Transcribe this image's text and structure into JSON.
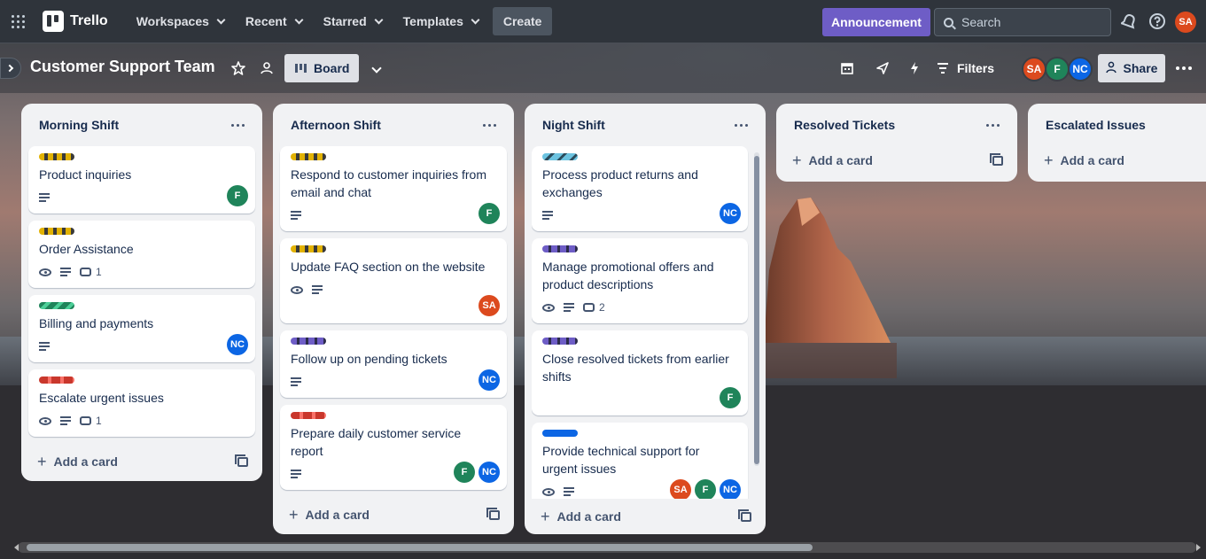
{
  "topnav": {
    "logo": "Trello",
    "menus": [
      "Workspaces",
      "Recent",
      "Starred",
      "Templates"
    ],
    "create_label": "Create",
    "announcement_label": "Announcement",
    "search_placeholder": "Search",
    "user_initials": "SA"
  },
  "board": {
    "title": "Customer Support Team",
    "view_label": "Board",
    "filters_label": "Filters",
    "share_label": "Share",
    "members": [
      "SA",
      "F",
      "NC"
    ]
  },
  "lists": [
    {
      "title": "Morning Shift",
      "add_card_label": "Add a card",
      "cards": [
        {
          "title": "Product inquiries",
          "label": "yellow",
          "badges": [
            "description"
          ],
          "members": [
            "F"
          ]
        },
        {
          "title": "Order Assistance",
          "label": "yellow",
          "badges": [
            "watch",
            "description"
          ],
          "comments": "1",
          "members": []
        },
        {
          "title": "Billing and payments",
          "label": "green",
          "badges": [
            "description"
          ],
          "members": [
            "NC"
          ]
        },
        {
          "title": "Escalate urgent issues",
          "label": "red",
          "badges": [
            "watch",
            "description"
          ],
          "comments": "1",
          "members": []
        }
      ]
    },
    {
      "title": "Afternoon Shift",
      "add_card_label": "Add a card",
      "cards": [
        {
          "title": "Respond to customer inquiries from email and chat",
          "label": "yellow",
          "badges": [
            "description"
          ],
          "members": [
            "F"
          ]
        },
        {
          "title": "Update FAQ section on the website",
          "label": "yellow",
          "badges": [
            "watch",
            "description"
          ],
          "members": [
            "SA"
          ]
        },
        {
          "title": "Follow up on pending tickets",
          "label": "purple",
          "badges": [
            "description"
          ],
          "members": [
            "NC"
          ]
        },
        {
          "title": "Prepare daily customer service report",
          "label": "red",
          "badges": [
            "description"
          ],
          "members": [
            "F",
            "NC"
          ]
        }
      ]
    },
    {
      "title": "Night Shift",
      "add_card_label": "Add a card",
      "cards": [
        {
          "title": "Process product returns and exchanges",
          "label": "teal",
          "badges": [
            "description"
          ],
          "members": [
            "NC"
          ]
        },
        {
          "title": "Manage promotional offers and product descriptions",
          "label": "purple",
          "badges": [
            "watch",
            "description"
          ],
          "comments": "2",
          "members": []
        },
        {
          "title": "Close resolved tickets from earlier shifts",
          "label": "purple",
          "badges": [],
          "members": [
            "F"
          ]
        },
        {
          "title": "Provide technical support for urgent issues",
          "label": "blue",
          "badges": [
            "watch",
            "description"
          ],
          "members": [
            "SA",
            "F",
            "NC"
          ]
        }
      ]
    },
    {
      "title": "Resolved Tickets",
      "add_card_label": "Add a card",
      "cards": []
    },
    {
      "title": "Escalated Issues",
      "add_card_label": "Add a card",
      "cards": []
    }
  ],
  "colors": {
    "topnav_bg": "#2f343b",
    "announcement": "#6e5dc6",
    "avatar_sa": "#dc4a1e",
    "avatar_f": "#1f845a",
    "avatar_nc": "#0c66e4",
    "list_bg": "#f1f2f4"
  }
}
